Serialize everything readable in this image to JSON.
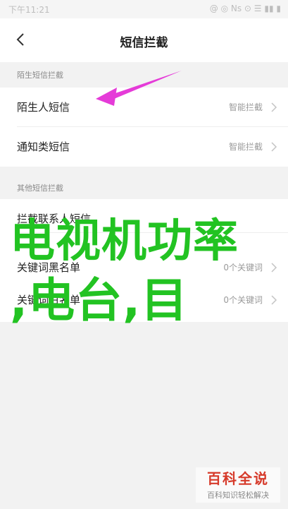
{
  "status_bar": {
    "time": "下午11:21",
    "indicators": "@ ◎ Ns ⊙ ☰ ▮▮ ▮"
  },
  "header": {
    "title": "短信拦截",
    "back_icon": "chevron-left-icon"
  },
  "sections": [
    {
      "label": "陌生短信拦截",
      "items": [
        {
          "label": "陌生人短信",
          "value": "智能拦截"
        },
        {
          "label": "通知类短信",
          "value": "智能拦截"
        }
      ]
    },
    {
      "label": "其他短信拦截",
      "items": [
        {
          "label": "拦截联系人短信",
          "value": ""
        },
        {
          "label": "关键词黑名单",
          "value": "0个关键词"
        },
        {
          "label": "关键词白名单",
          "value": "0个关键词"
        }
      ]
    }
  ],
  "overlay_text": {
    "line1": "电视机功率",
    "line2": ",电台,目"
  },
  "watermark": {
    "main": "百科全说",
    "sub": "百科知识轻松解决"
  },
  "colors": {
    "arrow": "#e53bd8",
    "overlay": "#22c322",
    "watermark": "#d63a2a"
  }
}
